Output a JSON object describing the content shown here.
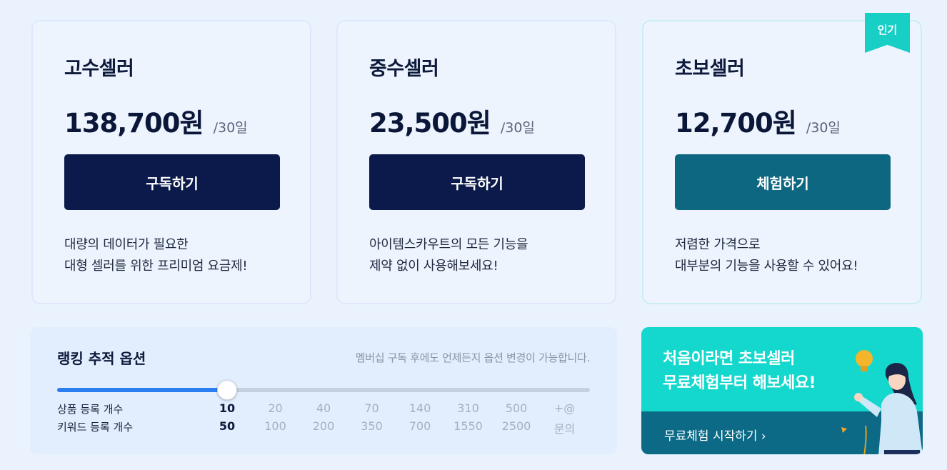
{
  "plans": [
    {
      "title": "고수셀러",
      "price": "138,700원",
      "period": "/30일",
      "button": "구독하기",
      "desc_line1": "대량의 데이터가 필요한",
      "desc_line2": "대형 셀러를 위한 프리미엄 요금제!"
    },
    {
      "title": "중수셀러",
      "price": "23,500원",
      "period": "/30일",
      "button": "구독하기",
      "desc_line1": "아이템스카우트의 모든 기능을",
      "desc_line2": "제약 없이 사용해보세요!"
    },
    {
      "title": "초보셀러",
      "price": "12,700원",
      "period": "/30일",
      "button": "체험하기",
      "badge": "인기",
      "desc_line1": "저렴한 가격으로",
      "desc_line2": "대부분의 기능을 사용할 수 있어요!"
    }
  ],
  "ranking": {
    "title": "랭킹 추적 옵션",
    "note": "멤버십 구독 후에도 언제든지 옵션 변경이 가능합니다.",
    "product_label": "상품 등록 개수",
    "keyword_label": "키워드 등록 개수",
    "product_values": [
      "10",
      "20",
      "40",
      "70",
      "140",
      "310",
      "500",
      "+@"
    ],
    "keyword_values": [
      "50",
      "100",
      "200",
      "350",
      "700",
      "1550",
      "2500",
      "문의"
    ],
    "selected_index": 0
  },
  "promo": {
    "line1": "처음이라면 초보셀러",
    "line2": "무료체험부터 해보세요!",
    "cta": "무료체험 시작하기 ›"
  },
  "colors": {
    "primary_button": "#0b1a4a",
    "trial_button": "#0d6781",
    "accent_teal": "#18cfc6",
    "slider_fill": "#2a7ef0"
  }
}
